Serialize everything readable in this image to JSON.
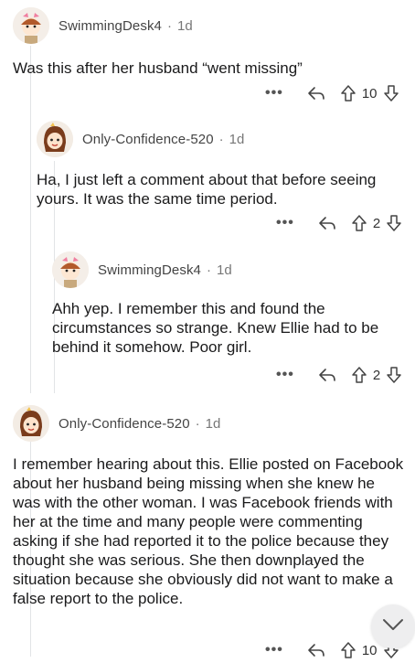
{
  "comments": [
    {
      "author": "SwimmingDesk4",
      "age": "1d",
      "text": "Was this after her husband “went missing”",
      "votes": "10"
    },
    {
      "author": "Only-Confidence-520",
      "age": "1d",
      "text": "Ha, I just left a comment about that before seeing yours. It was the same time period.",
      "votes": "2"
    },
    {
      "author": "SwimmingDesk4",
      "age": "1d",
      "text": "Ahh yep. I remember this and found the circumstances so strange. Knew Ellie had to be behind it somehow. Poor girl.",
      "votes": "2"
    },
    {
      "author": "Only-Confidence-520",
      "age": "1d",
      "text": "I remember hearing about this. Ellie posted on Facebook about her husband being missing when she knew he was with the other woman. I was Facebook friends with her at the time and many people were commenting asking if she had reported it to the police because they thought she was serious. She then downplayed the situation because she obviously did not want to make a false report to the police.",
      "votes": "10"
    }
  ],
  "ui": {
    "separator": "·",
    "more": "•••"
  },
  "icons": {
    "reply": "reply-arrow-icon",
    "upvote": "upvote-arrow-icon",
    "downvote": "downvote-arrow-icon",
    "more": "more-options-icon",
    "collapse": "chevron-down-icon"
  },
  "colors": {
    "background": "#ffffff",
    "text": "#1a1a1b",
    "meta": "#777777",
    "thread_line": "#e2e4e6"
  }
}
